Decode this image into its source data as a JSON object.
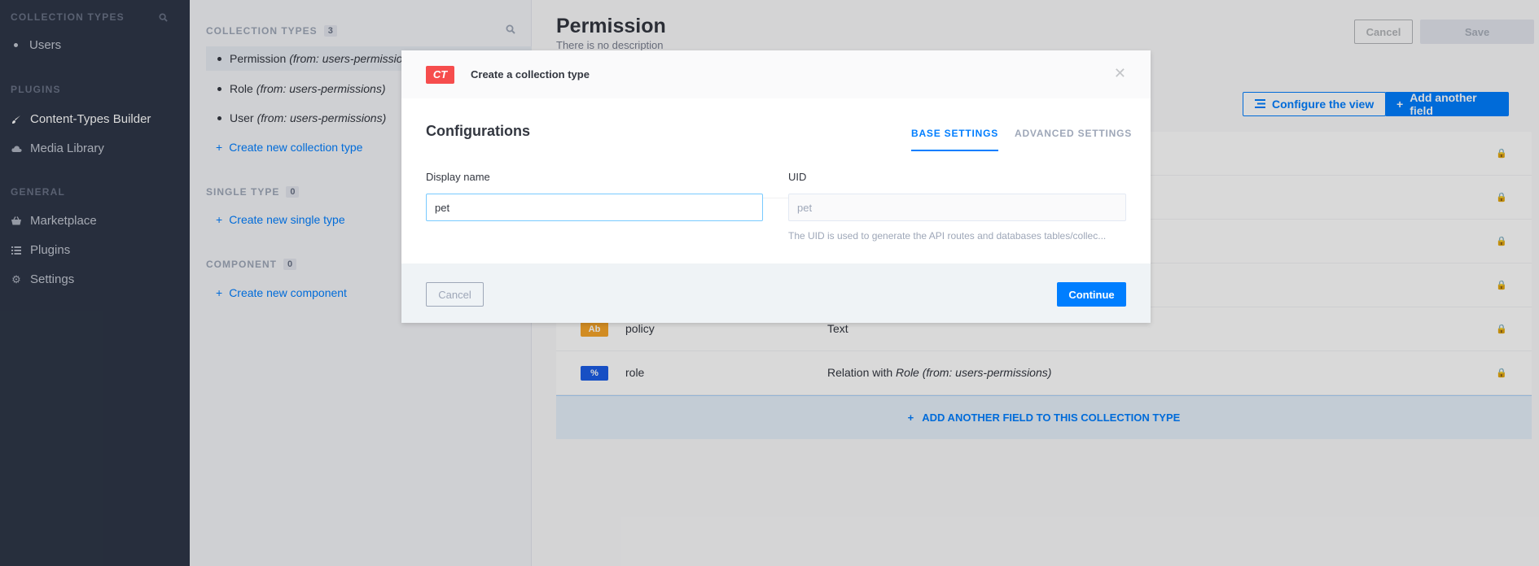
{
  "leftnav": {
    "section_collection_types": "COLLECTION TYPES",
    "collection_items": [
      {
        "label": "Users"
      }
    ],
    "section_plugins": "PLUGINS",
    "plugins": [
      {
        "label": "Content-Types Builder",
        "icon": "paintbrush-icon"
      },
      {
        "label": "Media Library",
        "icon": "cloud-icon"
      }
    ],
    "section_general": "GENERAL",
    "general": [
      {
        "label": "Marketplace",
        "icon": "basket-icon"
      },
      {
        "label": "Plugins",
        "icon": "list-icon"
      },
      {
        "label": "Settings",
        "icon": "gear-icon"
      }
    ]
  },
  "ctbuilder": {
    "collection_types_label": "COLLECTION TYPES",
    "collection_types_count": "3",
    "collection_types": [
      {
        "name": "Permission",
        "from": "(from: users-permissions)"
      },
      {
        "name": "Role",
        "from": "(from: users-permissions)"
      },
      {
        "name": "User",
        "from": "(from: users-permissions)"
      }
    ],
    "create_collection": "Create new collection type",
    "single_type_label": "SINGLE TYPE",
    "single_type_count": "0",
    "create_single": "Create new single type",
    "component_label": "COMPONENT",
    "component_count": "0",
    "create_component": "Create new component"
  },
  "main": {
    "title": "Permission",
    "subtitle": "There is no description",
    "cancel": "Cancel",
    "save": "Save",
    "configure_view": "Configure the view",
    "add_field": "Add another field",
    "fields": [
      {
        "icon_label": "",
        "name": "",
        "type": ""
      },
      {
        "icon_label": "",
        "name": "",
        "type": ""
      },
      {
        "icon_label": "",
        "name": "",
        "type": ""
      },
      {
        "icon_label": "",
        "name": "",
        "type": ""
      },
      {
        "icon_label": "Ab",
        "name": "policy",
        "type": "Text"
      },
      {
        "icon_label": "%",
        "name": "role",
        "type_prefix": "Relation with",
        "type_italic": "Role (from: users-permissions)"
      }
    ],
    "add_another_field": "ADD ANOTHER FIELD TO THIS COLLECTION TYPE"
  },
  "modal": {
    "badge": "CT",
    "title": "Create a collection type",
    "section_title": "Configurations",
    "tabs": [
      "BASE SETTINGS",
      "ADVANCED SETTINGS"
    ],
    "display_name_label": "Display name",
    "display_name_value": "pet",
    "uid_label": "UID",
    "uid_value": "pet",
    "uid_help": "The UID is used to generate the API routes and databases tables/collec...",
    "cancel": "Cancel",
    "continue": "Continue"
  },
  "colors": {
    "accent": "#007eff",
    "nav_bg": "#2e3748",
    "ct_badge": "#f64d4d",
    "text_badge": "#f6a52a",
    "relation_badge": "#1c5de7"
  }
}
